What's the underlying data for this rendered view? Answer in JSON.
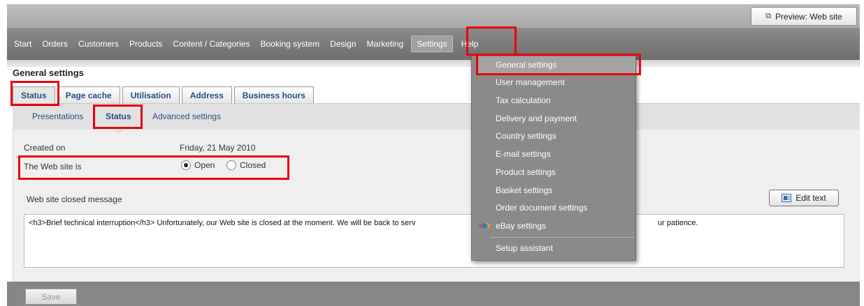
{
  "header": {
    "preview_label": "Preview: Web site"
  },
  "nav": {
    "items": [
      "Start",
      "Orders",
      "Customers",
      "Products",
      "Content / Categories",
      "Booking system",
      "Design",
      "Marketing",
      "Settings",
      "Help"
    ],
    "active": "Settings"
  },
  "page": {
    "title": "General settings"
  },
  "tabs": [
    "Status",
    "Page cache",
    "Utilisation",
    "Address",
    "Business hours"
  ],
  "subtabs": [
    "Presentations",
    "Status",
    "Advanced settings"
  ],
  "status": {
    "created_label": "Created on",
    "created_value": "Friday, 21 May 2010",
    "website_label": "The Web site is",
    "open_label": "Open",
    "closed_label": "Closed",
    "selected": "Open"
  },
  "message": {
    "label": "Web site closed message",
    "edit_button": "Edit text",
    "text": "<h3>Brief technical interruption</h3> Unfortunately, our Web site is closed at the moment. We will be back to serv",
    "text_tail": "ur patience."
  },
  "footer": {
    "save_label": "Save"
  },
  "dropdown": {
    "items": [
      "General settings",
      "User management",
      "Tax calculation",
      "Delivery and payment",
      "Country settings",
      "E-mail settings",
      "Product settings",
      "Basket settings",
      "Order document settings",
      "eBay settings",
      "Setup assistant"
    ],
    "ebay_logo": "ebY"
  },
  "colors": {
    "highlight": "#e8000f",
    "link": "#2b4d88",
    "nav_bg": "#7a7a7a",
    "menu_bg": "#8a8a8a"
  }
}
